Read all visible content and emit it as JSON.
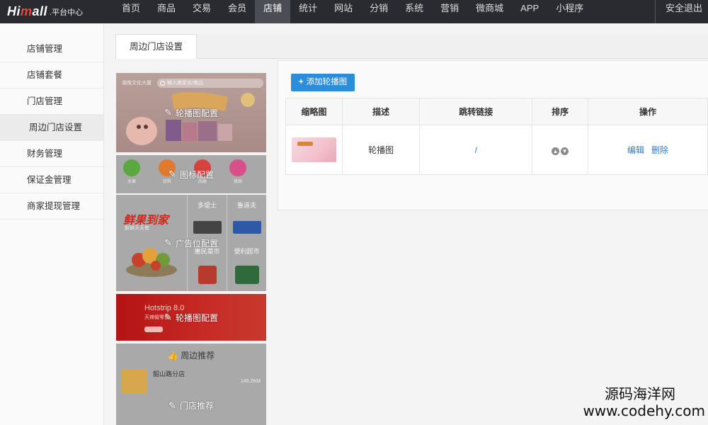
{
  "topbar": {
    "brand_a": "Hi",
    "brand_b": "m",
    "brand_c": "all",
    "brand_sub": ".平台中心",
    "nav": [
      "首页",
      "商品",
      "交易",
      "会员",
      "店铺",
      "统计",
      "网站",
      "分销",
      "系统",
      "营销",
      "微商城",
      "APP",
      "小程序"
    ],
    "active_nav": "店铺",
    "logout": "安全退出"
  },
  "sidebar": {
    "items": [
      "店铺管理",
      "店铺套餐",
      "门店管理",
      "周边门店设置",
      "财务管理",
      "保证金管理",
      "商家提现管理"
    ],
    "active": "周边门店设置"
  },
  "main": {
    "tab": "周边门店设置",
    "preview": {
      "banner_top": {
        "location": "湖南文化大厦",
        "search_placeholder": "输入商家名/商品",
        "edit_label": "轮播图配置"
      },
      "icons": {
        "edit_label": "图标配置",
        "items": [
          {
            "label": "水果",
            "color": "#5aa83e"
          },
          {
            "label": "饮料",
            "color": "#e07a2f"
          },
          {
            "label": "肉类",
            "color": "#d9413c"
          },
          {
            "label": "烘焙",
            "color": "#d94f8a"
          }
        ]
      },
      "ads": {
        "edit_label": "广告位配置",
        "brand_text": "鲜果到家",
        "brand_sub": "新鲜天天有",
        "cells": [
          "多堤士",
          "鲁道夫",
          "惠民菜市",
          "便利超市"
        ]
      },
      "banner_bottom": {
        "title": "Hotstrip 8.0",
        "sub": "天辣椒零食",
        "edit_label": "轮播图配置"
      },
      "nearby": {
        "header": "周边推荐",
        "shop_name": "韶山路分店",
        "distance": "145.2KM",
        "edit_label": "门店推荐"
      }
    },
    "panel": {
      "add_button": "添加轮播图",
      "columns": [
        "缩略图",
        "描述",
        "跳转链接",
        "排序",
        "操作"
      ],
      "rows": [
        {
          "desc": "轮播图",
          "link": "/",
          "actions": [
            "编辑",
            "删除"
          ]
        }
      ]
    }
  },
  "watermark": {
    "line1": "源码海洋网",
    "line2": "www.codehy.com"
  },
  "colors": {
    "topbar": "#2a2b30",
    "accent": "#2c8ddb",
    "link": "#2c7bd0"
  }
}
